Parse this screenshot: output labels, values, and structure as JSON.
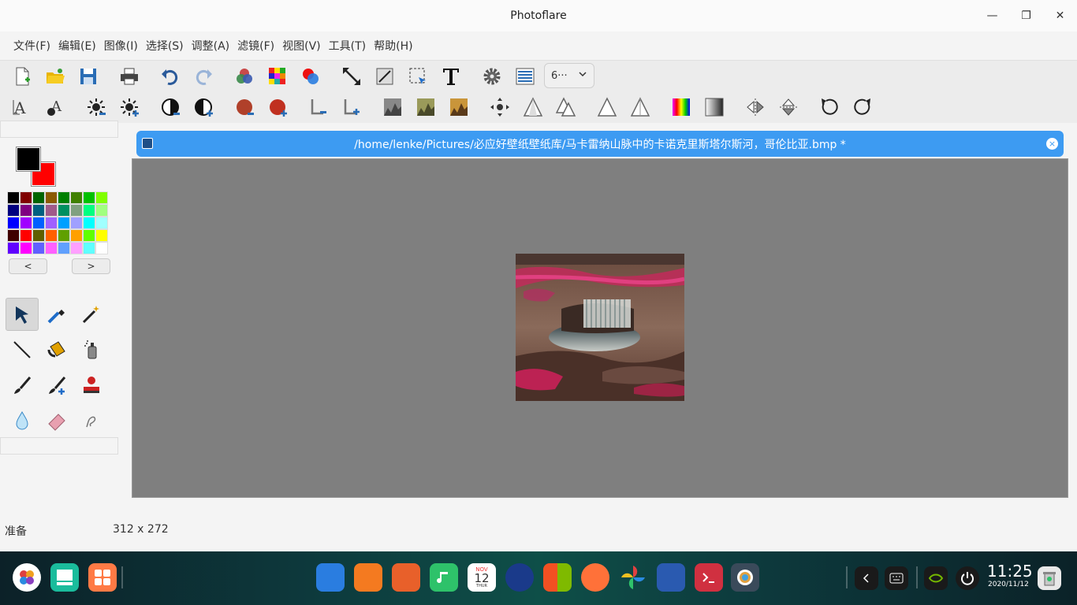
{
  "window": {
    "title": "Photoflare",
    "minimize_glyph": "—",
    "maximize_glyph": "❐",
    "close_glyph": "✕"
  },
  "menu": [
    "文件(F)",
    "编辑(E)",
    "图像(I)",
    "选择(S)",
    "调整(A)",
    "滤镜(F)",
    "视图(V)",
    "工具(T)",
    "帮助(H)"
  ],
  "toolbar": {
    "zoom_value": "6···",
    "row1_icons": [
      "new-file-icon",
      "open-folder-icon",
      "save-icon",
      "print-icon",
      "undo-icon",
      "redo-icon",
      "color-mix-icon",
      "mosaic-icon",
      "color-circles-icon",
      "resize-arrow-icon",
      "crop-icon",
      "select-arrow-icon",
      "text-icon",
      "settings-icon",
      "batch-icon"
    ],
    "row2_icons": [
      "font-a-icon",
      "font-b-icon",
      "brightness-down-icon",
      "brightness-up-icon",
      "contrast-down-icon",
      "contrast-up-icon",
      "saturation-down-icon",
      "saturation-up-icon",
      "levels-down-icon",
      "levels-up-icon",
      "histogram-gray-icon",
      "histogram-olive-icon",
      "histogram-sepia-icon",
      "move-icon",
      "triangle-a-icon",
      "triangle-b-icon",
      "triangle-c-icon",
      "triangle-d-icon",
      "gradient-color-icon",
      "gradient-gray-icon",
      "flip-horizontal-icon",
      "flip-vertical-icon",
      "rotate-ccw-icon",
      "rotate-cw-icon"
    ]
  },
  "colors": {
    "foreground": "#000000",
    "background": "#ff0000",
    "palette": [
      "#000000",
      "#800000",
      "#006400",
      "#8b5a00",
      "#008000",
      "#408000",
      "#00c000",
      "#80ff00",
      "#000080",
      "#800080",
      "#006080",
      "#a05a8a",
      "#009060",
      "#80a080",
      "#00ff80",
      "#a0ff80",
      "#0000ff",
      "#a000ff",
      "#0060ff",
      "#a060ff",
      "#00a0ff",
      "#a0a0ff",
      "#00ffff",
      "#a0ffff",
      "#400000",
      "#ff0000",
      "#606000",
      "#ff6000",
      "#60a000",
      "#ffa000",
      "#60ff00",
      "#ffff00",
      "#6000ff",
      "#ff00ff",
      "#6060ff",
      "#ff60ff",
      "#60a0ff",
      "#ffa0ff",
      "#60ffff",
      "#ffffff"
    ],
    "prev_label": "<",
    "next_label": ">"
  },
  "tools": [
    "pointer-icon",
    "eyedropper-icon",
    "magic-wand-icon",
    "line-icon",
    "paint-bucket-icon",
    "spray-can-icon",
    "brush-icon",
    "brush-plus-icon",
    "stamp-icon",
    "blur-drop-icon",
    "eraser-icon",
    "smudge-icon"
  ],
  "document": {
    "path": "/home/lenke/Pictures/必应好壁纸壁纸库/马卡雷纳山脉中的卡诺克里斯塔尔斯河，哥伦比亚.bmp *",
    "close_glyph": "×"
  },
  "status": {
    "ready": "准备",
    "size": "312 x 272"
  },
  "taskbar": {
    "time": "11:25",
    "date": "2020/11/12",
    "calendar_month": "NOV",
    "calendar_day": "12",
    "calendar_weekday": "THUR"
  }
}
